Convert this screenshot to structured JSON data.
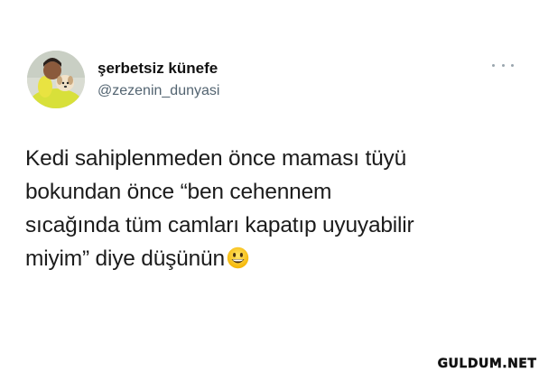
{
  "author": {
    "display_name": "şerbetsiz künefe",
    "handle": "@zezenin_dunyasi"
  },
  "tweet": {
    "lines": [
      "Kedi sahiplenmeden önce maması tüyü",
      "bokundan önce “ben cehennem",
      "sıcağında tüm camları kapatıp uyuyabilir",
      "miyim” diye düşünün"
    ],
    "emoji": "grinning-face-emoji"
  },
  "watermark": "GULDUM.NET",
  "icons": {
    "more": "more-horizontal-icon"
  },
  "colors": {
    "handle": "#536471",
    "text": "#1c1c1c",
    "background": "#ffffff"
  }
}
